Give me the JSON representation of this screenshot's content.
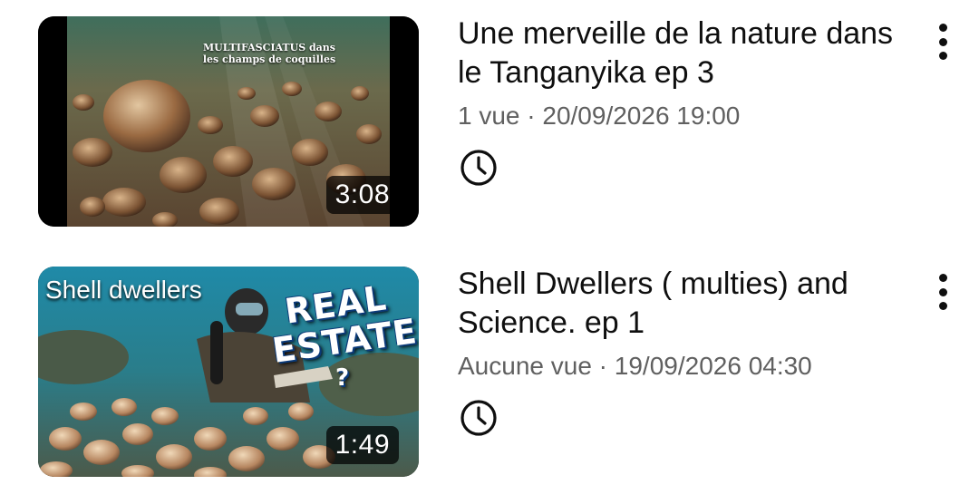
{
  "videos": [
    {
      "title": "Une merveille de la nature dans le Tanganyika ep 3",
      "meta": "1 vue · 20/09/2026 19:00",
      "duration": "3:08",
      "thumbnail_text": "MULTIFASCIATUS dans les champs de coquilles",
      "icons": [
        "clock-icon",
        "more-vert-icon"
      ]
    },
    {
      "title": "Shell Dwellers ( multies) and Science. ep 1",
      "meta": "Aucune vue · 19/09/2026 04:30",
      "duration": "1:49",
      "thumbnail_text": {
        "caption": "Shell dwellers",
        "headline_1": "REAL",
        "headline_2": "ESTATE",
        "mark": "?"
      },
      "icons": [
        "clock-icon",
        "more-vert-icon"
      ]
    }
  ]
}
